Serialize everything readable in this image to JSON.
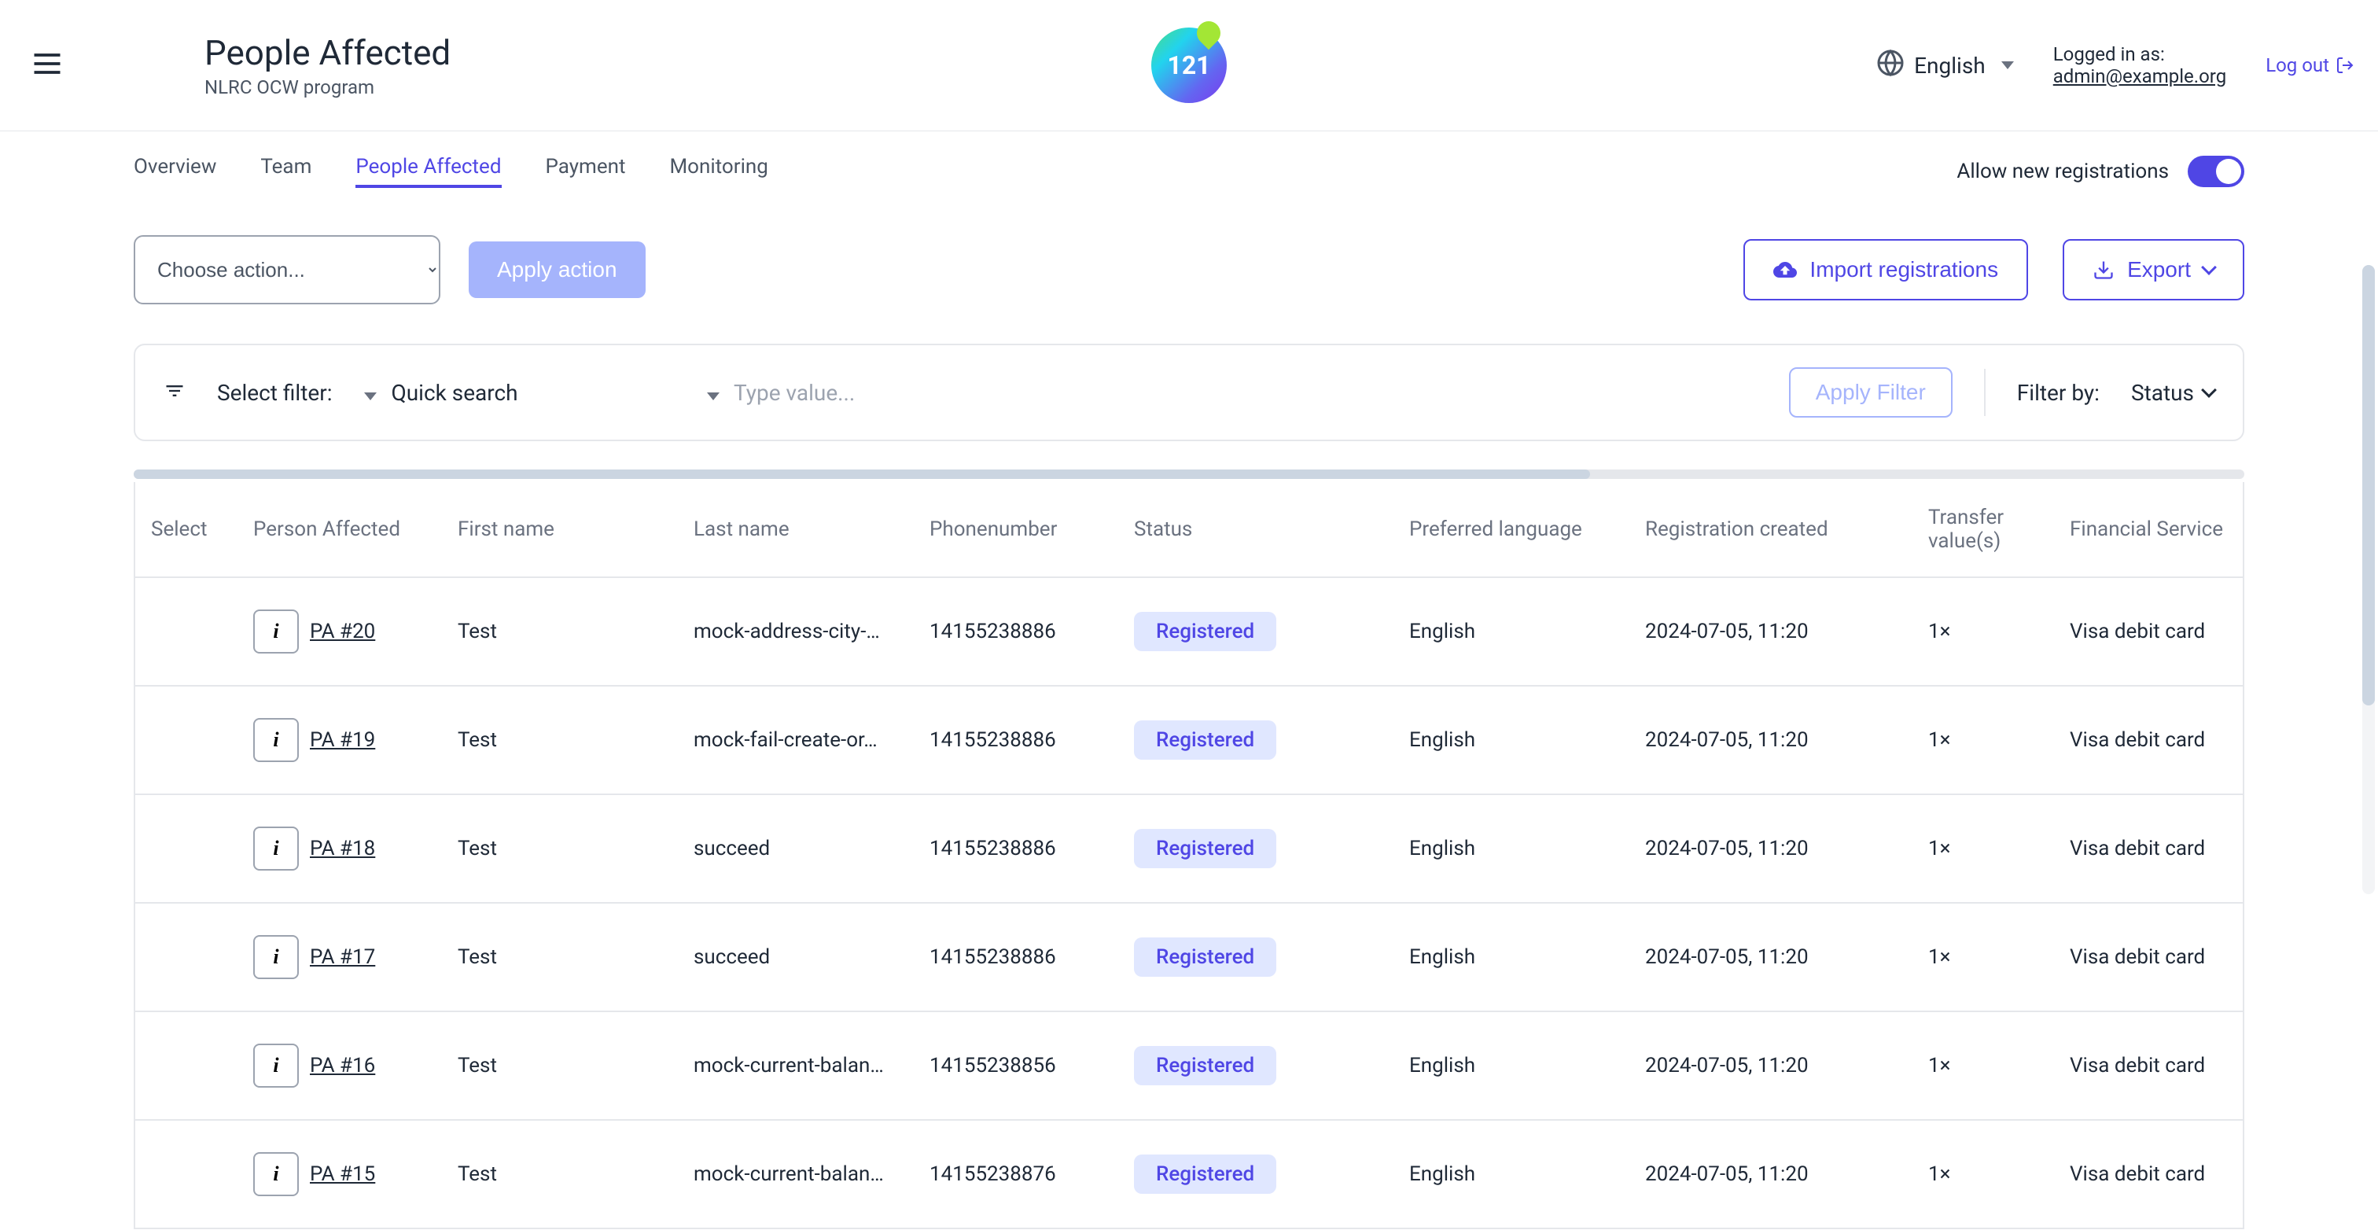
{
  "header": {
    "title": "People Affected",
    "subtitle": "NLRC OCW program",
    "logo_text": "121",
    "language": "English",
    "logged_in_label": "Logged in as:",
    "logged_in_email": "admin@example.org",
    "logout": "Log out"
  },
  "tabs": {
    "items": [
      "Overview",
      "Team",
      "People Affected",
      "Payment",
      "Monitoring"
    ],
    "active_index": 2,
    "allow_new_label": "Allow new registrations"
  },
  "actions": {
    "choose_action": "Choose action...",
    "apply_action": "Apply action",
    "import_reg": "Import registrations",
    "export": "Export"
  },
  "filter": {
    "select_filter": "Select filter:",
    "quick_search": "Quick search",
    "type_value": "Type value...",
    "apply_filter": "Apply Filter",
    "filter_by": "Filter by:",
    "status": "Status"
  },
  "table": {
    "columns": [
      "Select",
      "Person Affected",
      "First name",
      "Last name",
      "Phonenumber",
      "Status",
      "Preferred language",
      "Registration created",
      "Transfer value(s)",
      "Financial Service"
    ],
    "rows": [
      {
        "pa": "PA #20",
        "first": "Test",
        "last": "mock-address-city-…",
        "phone": "14155238886",
        "status": "Registered",
        "lang": "English",
        "created": "2024-07-05, 11:20",
        "transfer": "1×",
        "fsp": "Visa debit card"
      },
      {
        "pa": "PA #19",
        "first": "Test",
        "last": "mock-fail-create-or…",
        "phone": "14155238886",
        "status": "Registered",
        "lang": "English",
        "created": "2024-07-05, 11:20",
        "transfer": "1×",
        "fsp": "Visa debit card"
      },
      {
        "pa": "PA #18",
        "first": "Test",
        "last": "succeed",
        "phone": "14155238886",
        "status": "Registered",
        "lang": "English",
        "created": "2024-07-05, 11:20",
        "transfer": "1×",
        "fsp": "Visa debit card"
      },
      {
        "pa": "PA #17",
        "first": "Test",
        "last": "succeed",
        "phone": "14155238886",
        "status": "Registered",
        "lang": "English",
        "created": "2024-07-05, 11:20",
        "transfer": "1×",
        "fsp": "Visa debit card"
      },
      {
        "pa": "PA #16",
        "first": "Test",
        "last": "mock-current-balan…",
        "phone": "14155238856",
        "status": "Registered",
        "lang": "English",
        "created": "2024-07-05, 11:20",
        "transfer": "1×",
        "fsp": "Visa debit card"
      },
      {
        "pa": "PA #15",
        "first": "Test",
        "last": "mock-current-balan…",
        "phone": "14155238876",
        "status": "Registered",
        "lang": "English",
        "created": "2024-07-05, 11:20",
        "transfer": "1×",
        "fsp": "Visa debit card"
      }
    ]
  }
}
